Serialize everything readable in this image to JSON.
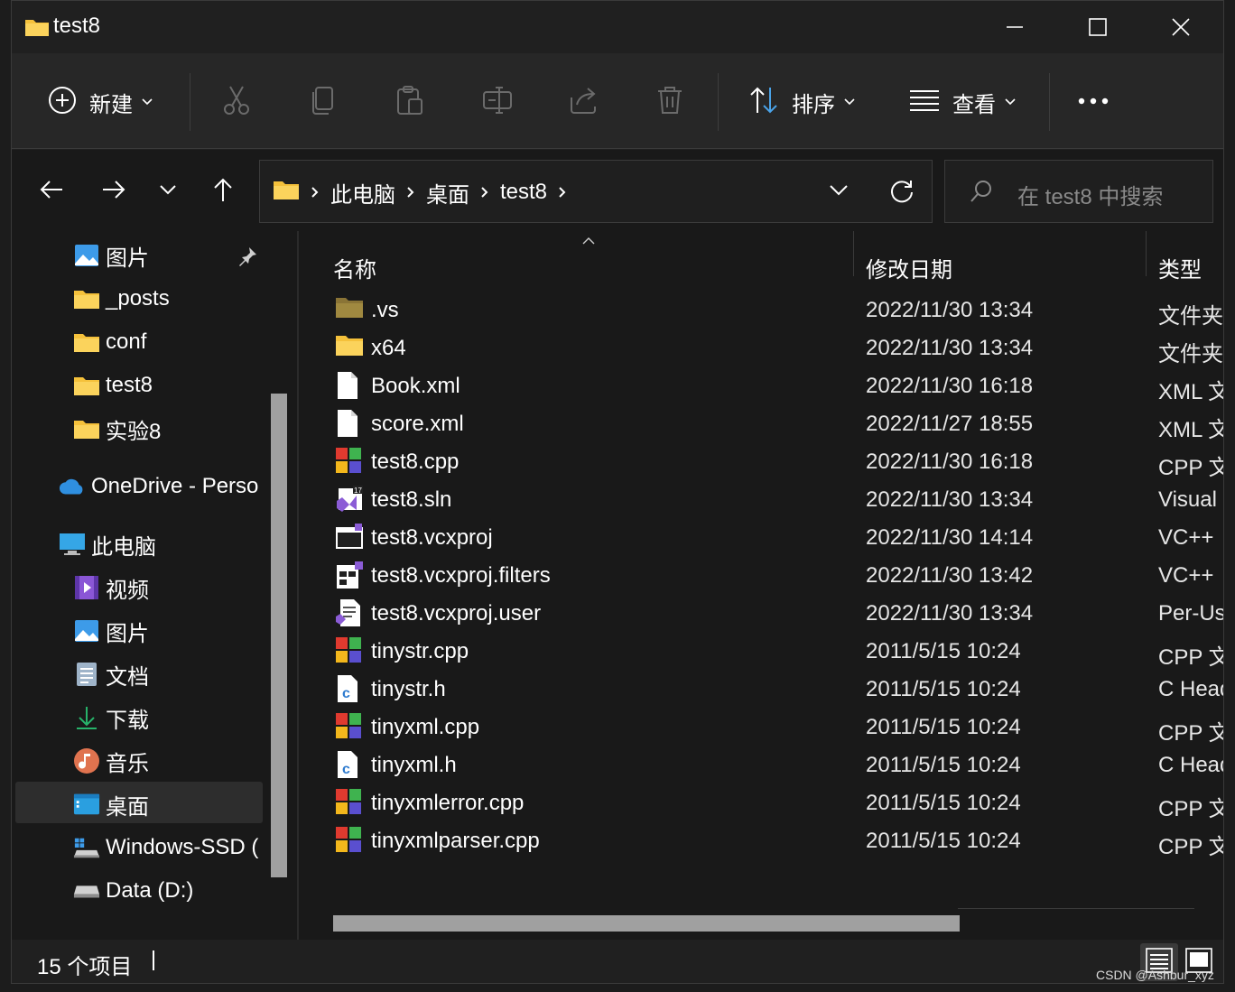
{
  "window": {
    "title": "test8"
  },
  "toolbar": {
    "new_label": "新建",
    "sort_label": "排序",
    "view_label": "查看"
  },
  "address": {
    "crumbs": [
      "此电脑",
      "桌面",
      "test8"
    ]
  },
  "search": {
    "placeholder": "在 test8 中搜索"
  },
  "sidebar": {
    "items": [
      {
        "label": "图片",
        "icon": "pictures-icon"
      },
      {
        "label": "_posts",
        "icon": "folder-icon"
      },
      {
        "label": "conf",
        "icon": "folder-icon"
      },
      {
        "label": "test8",
        "icon": "folder-icon"
      },
      {
        "label": "实验8",
        "icon": "folder-icon"
      },
      {
        "label": "OneDrive - Perso",
        "icon": "onedrive-icon"
      },
      {
        "label": "此电脑",
        "icon": "this-pc-icon"
      },
      {
        "label": "视频",
        "icon": "videos-icon"
      },
      {
        "label": "图片",
        "icon": "pictures-icon"
      },
      {
        "label": "文档",
        "icon": "documents-icon"
      },
      {
        "label": "下载",
        "icon": "downloads-icon"
      },
      {
        "label": "音乐",
        "icon": "music-icon"
      },
      {
        "label": "桌面",
        "icon": "desktop-icon"
      },
      {
        "label": "Windows-SSD (",
        "icon": "drive-c-icon"
      },
      {
        "label": "Data (D:)",
        "icon": "drive-d-icon"
      }
    ],
    "selected": "桌面"
  },
  "columns": {
    "name": "名称",
    "date": "修改日期",
    "type": "类型"
  },
  "files": [
    {
      "name": ".vs",
      "date": "2022/11/30 13:34",
      "type": "文件夹",
      "icon": "hidden-folder-icon"
    },
    {
      "name": "x64",
      "date": "2022/11/30 13:34",
      "type": "文件夹",
      "icon": "folder-icon"
    },
    {
      "name": "Book.xml",
      "date": "2022/11/30 16:18",
      "type": "XML 文",
      "icon": "blank-file-icon"
    },
    {
      "name": "score.xml",
      "date": "2022/11/27 18:55",
      "type": "XML 文",
      "icon": "blank-file-icon"
    },
    {
      "name": "test8.cpp",
      "date": "2022/11/30 16:18",
      "type": "CPP 文",
      "icon": "cpp-file-icon"
    },
    {
      "name": "test8.sln",
      "date": "2022/11/30 13:34",
      "type": "Visual",
      "icon": "vs-solution-icon"
    },
    {
      "name": "test8.vcxproj",
      "date": "2022/11/30 14:14",
      "type": "VC++",
      "icon": "vcxproj-icon"
    },
    {
      "name": "test8.vcxproj.filters",
      "date": "2022/11/30 13:42",
      "type": "VC++",
      "icon": "filters-file-icon"
    },
    {
      "name": "test8.vcxproj.user",
      "date": "2022/11/30 13:34",
      "type": "Per-Us",
      "icon": "user-file-icon"
    },
    {
      "name": "tinystr.cpp",
      "date": "2011/5/15 10:24",
      "type": "CPP 文",
      "icon": "cpp-file-icon"
    },
    {
      "name": "tinystr.h",
      "date": "2011/5/15 10:24",
      "type": "C Head",
      "icon": "c-header-icon"
    },
    {
      "name": "tinyxml.cpp",
      "date": "2011/5/15 10:24",
      "type": "CPP 文",
      "icon": "cpp-file-icon"
    },
    {
      "name": "tinyxml.h",
      "date": "2011/5/15 10:24",
      "type": "C Head",
      "icon": "c-header-icon"
    },
    {
      "name": "tinyxmlerror.cpp",
      "date": "2011/5/15 10:24",
      "type": "CPP 文",
      "icon": "cpp-file-icon"
    },
    {
      "name": "tinyxmlparser.cpp",
      "date": "2011/5/15 10:24",
      "type": "CPP 文",
      "icon": "cpp-file-icon"
    }
  ],
  "status": {
    "count": "15 个项目"
  },
  "watermark": "CSDN @Ashbur_xyz",
  "colors": {
    "folder": "#f5c13b",
    "accent": "#4aa3e8",
    "background": "#191919"
  }
}
